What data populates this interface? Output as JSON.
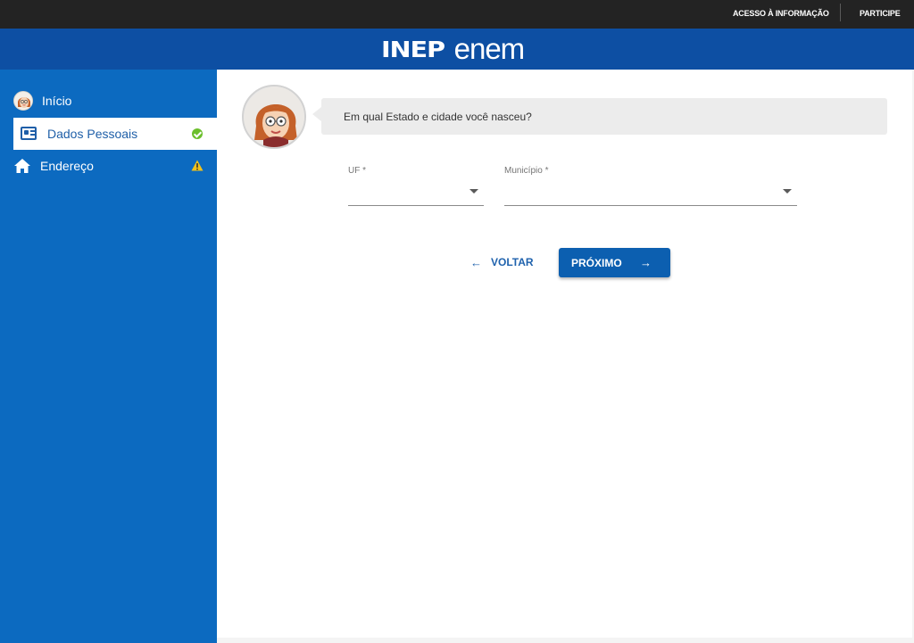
{
  "topbar": {
    "acesso_label": "ACESSO À INFORMAÇÃO",
    "participe_label": "PARTICIPE"
  },
  "brand": {
    "inep": "INEP",
    "enem": "enem"
  },
  "sidebar": {
    "items": [
      {
        "label": "Início",
        "icon": "avatar-icon",
        "status": ""
      },
      {
        "label": "Dados Pessoais",
        "icon": "id-card-icon",
        "status": "check-icon",
        "active": true
      },
      {
        "label": "Endereço",
        "icon": "home-icon",
        "status": "warning-icon"
      }
    ]
  },
  "main": {
    "question": "Em qual Estado e cidade você nasceu?",
    "fields": [
      {
        "label": "UF *",
        "value": ""
      },
      {
        "label": "Município *",
        "value": ""
      }
    ],
    "back_label": "VOLTAR",
    "next_label": "PRÓXIMO"
  },
  "colors": {
    "topbar": "#232323",
    "brandbar": "#0d4fa3",
    "sidebar": "#0c6ac0",
    "accent": "#0c5fb0",
    "check": "#6cbf2c",
    "warning": "#f2c21a"
  }
}
